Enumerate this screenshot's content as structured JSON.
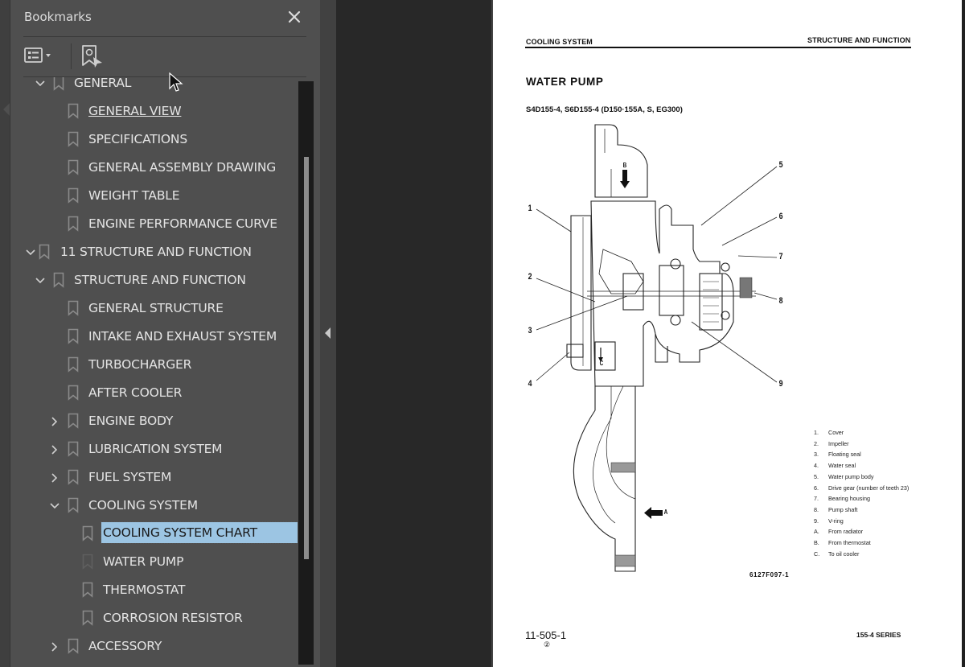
{
  "bookmarks_panel": {
    "title": "Bookmarks",
    "close_icon": "close-icon",
    "toolbar": {
      "options_icon": "list-options-icon",
      "find_current_icon": "find-current-bookmark-icon"
    },
    "items": [
      {
        "label": "GENERAL",
        "level": 1,
        "expander": "expanded"
      },
      {
        "label": "GENERAL VIEW",
        "level": 2,
        "expander": "none",
        "state": "link"
      },
      {
        "label": "SPECIFICATIONS",
        "level": 2,
        "expander": "none"
      },
      {
        "label": "GENERAL ASSEMBLY DRAWING",
        "level": 2,
        "expander": "none"
      },
      {
        "label": "WEIGHT TABLE",
        "level": 2,
        "expander": "none"
      },
      {
        "label": "ENGINE PERFORMANCE CURVE",
        "level": 2,
        "expander": "none"
      },
      {
        "label": "11 STRUCTURE AND FUNCTION",
        "level": 0,
        "expander": "expanded"
      },
      {
        "label": "STRUCTURE AND FUNCTION",
        "level": 1,
        "expander": "expanded"
      },
      {
        "label": "GENERAL STRUCTURE",
        "level": 2,
        "expander": "none"
      },
      {
        "label": "INTAKE AND EXHAUST SYSTEM",
        "level": 2,
        "expander": "none"
      },
      {
        "label": "TURBOCHARGER",
        "level": 2,
        "expander": "none"
      },
      {
        "label": "AFTER COOLER",
        "level": 2,
        "expander": "none"
      },
      {
        "label": "ENGINE BODY",
        "level": 2,
        "expander": "collapsed"
      },
      {
        "label": "LUBRICATION SYSTEM",
        "level": 2,
        "expander": "collapsed"
      },
      {
        "label": "FUEL SYSTEM",
        "level": 2,
        "expander": "collapsed"
      },
      {
        "label": "COOLING SYSTEM",
        "level": 2,
        "expander": "expanded"
      },
      {
        "label": "COOLING SYSTEM CHART",
        "level": 3,
        "expander": "none",
        "state": "selected"
      },
      {
        "label": "WATER PUMP",
        "level": 3,
        "expander": "none",
        "state": "current"
      },
      {
        "label": "THERMOSTAT",
        "level": 3,
        "expander": "none"
      },
      {
        "label": "CORROSION RESISTOR",
        "level": 3,
        "expander": "none"
      },
      {
        "label": "ACCESSORY",
        "level": 2,
        "expander": "collapsed"
      }
    ]
  },
  "document_page": {
    "header_left": "COOLING SYSTEM",
    "header_right": "STRUCTURE AND FUNCTION",
    "title": "WATER PUMP",
    "subtitle": "S4D155-4, S6D155-4   (D150·155A, S, EG300)",
    "figure": {
      "callouts": [
        "1",
        "2",
        "3",
        "4",
        "5",
        "6",
        "7",
        "8",
        "9"
      ],
      "flow_labels": [
        "A",
        "B",
        "C"
      ],
      "code": "6127F097-1"
    },
    "legend": [
      {
        "key": "1.",
        "text": "Cover"
      },
      {
        "key": "2.",
        "text": "Impeller"
      },
      {
        "key": "3.",
        "text": "Floating seal"
      },
      {
        "key": "4.",
        "text": "Water seal"
      },
      {
        "key": "5.",
        "text": "Water pump body"
      },
      {
        "key": "6.",
        "text": "Drive gear (number of teeth 23)"
      },
      {
        "key": "7.",
        "text": "Bearing housing"
      },
      {
        "key": "8.",
        "text": "Pump shaft"
      },
      {
        "key": "9.",
        "text": "V-ring"
      },
      {
        "key": "A.",
        "text": "From radiator"
      },
      {
        "key": "B.",
        "text": "From thermostat"
      },
      {
        "key": "C.",
        "text": "To oil cooler"
      }
    ],
    "page_number": "11-505-1",
    "revision": "②",
    "series": "155-4 SERIES"
  },
  "colors": {
    "panel_bg": "#4f4f4f",
    "viewer_bg": "#282828",
    "selection": "#9cc5e3",
    "text": "#e4e4e4"
  }
}
